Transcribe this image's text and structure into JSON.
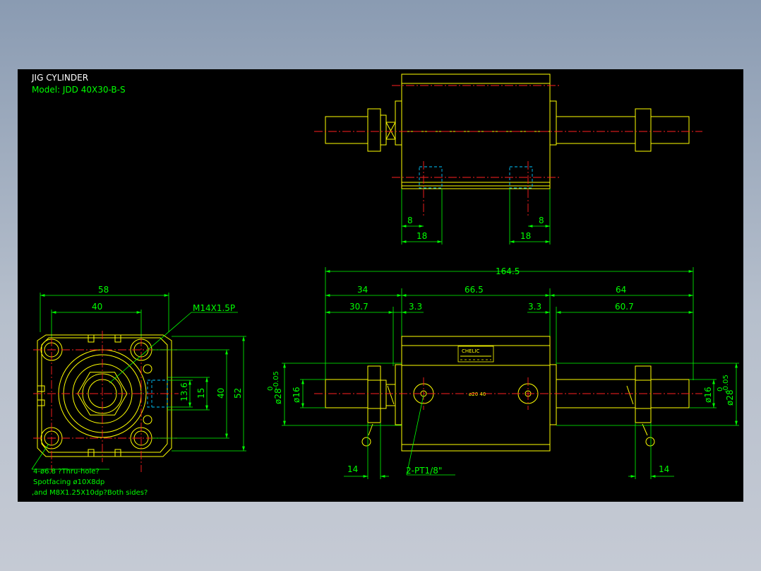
{
  "title": {
    "line1": "JIG CYLINDER",
    "line2": "Model: JDD 40X30-B-S"
  },
  "colors": {
    "background": "#000000",
    "outline": "#ffff00",
    "dimension": "#00ff00",
    "centerline": "#ff2020",
    "hidden": "#00c8ff",
    "title": "#ffffff"
  },
  "top_view": {
    "dims": {
      "left_small": "8",
      "left_big": "18",
      "right_small": "8",
      "right_big": "18"
    }
  },
  "side_view": {
    "label": "CHELIC",
    "dims": {
      "overall": "164.5",
      "d34": "34",
      "d665": "66.5",
      "d64": "64",
      "d307": "30.7",
      "d33a": "3.3",
      "d33b": "3.3",
      "d607": "60.7",
      "d14a": "14",
      "d14b": "14",
      "dia16_left": "ø16",
      "dia28_left": "ø28",
      "dia28_tol_left": "0",
      "dia28_tol2_left": "-0.05",
      "dia16_right": "ø16",
      "dia28_right": "ø28",
      "dia28_tol_right": "0",
      "dia28_tol2_right": "-0.05",
      "port_note": "2-PT1/8\"",
      "small_mark": "ø20 40"
    }
  },
  "front_view": {
    "dims": {
      "w58": "58",
      "w40": "40",
      "h136": "13.6",
      "h15": "15",
      "h40": "40",
      "h52": "52"
    },
    "thread_note": "M14X1.5P",
    "notes": [
      "4-ø6.8 ?Thru-hole?",
      "Spotfacing ø10X8dp",
      ",and M8X1.25X10dp?Both sides?"
    ]
  }
}
